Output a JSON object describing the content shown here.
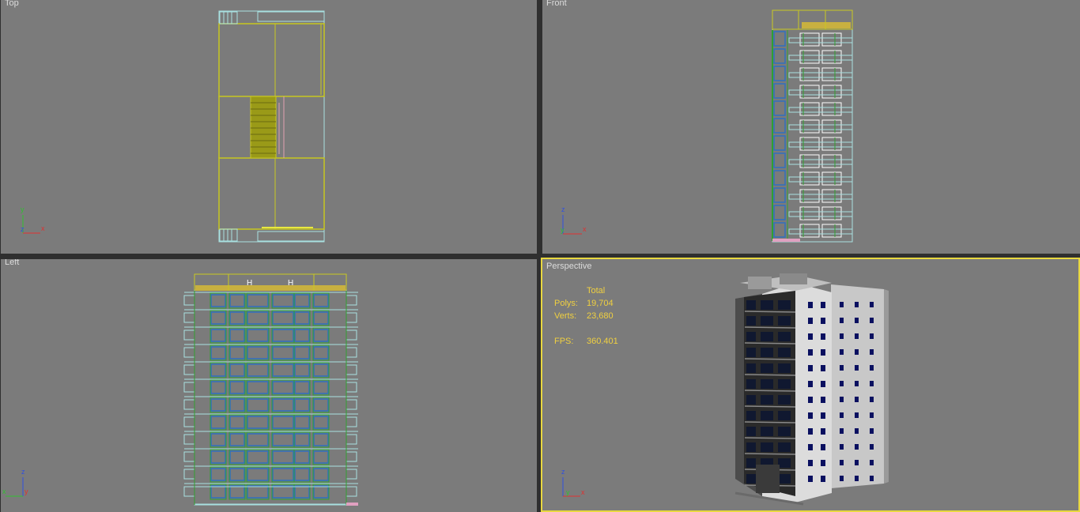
{
  "viewports": {
    "top": {
      "label": "Top"
    },
    "front": {
      "label": "Front"
    },
    "left": {
      "label": "Left"
    },
    "perspective": {
      "label": "Perspective"
    }
  },
  "stats": {
    "header": "Total",
    "polys_label": "Polys:",
    "polys_value": "19,704",
    "verts_label": "Verts:",
    "verts_value": "23,680",
    "fps_label": "FPS:",
    "fps_value": "360.401"
  },
  "axes": {
    "top": [
      "y",
      "z",
      "x"
    ],
    "front": [
      "z",
      "y",
      "x"
    ],
    "left": [
      "z",
      "x",
      "y"
    ],
    "perspective": [
      "z",
      "y",
      "x"
    ]
  },
  "colors": {
    "viewport_bg": "#7b7b7b",
    "active_border": "#e8d840",
    "wire_yellow": "#c8c820",
    "wire_green": "#30a030",
    "wire_blue": "#3070c0",
    "wire_cyan": "#a8e0e0",
    "stats_text": "#f0d040"
  }
}
